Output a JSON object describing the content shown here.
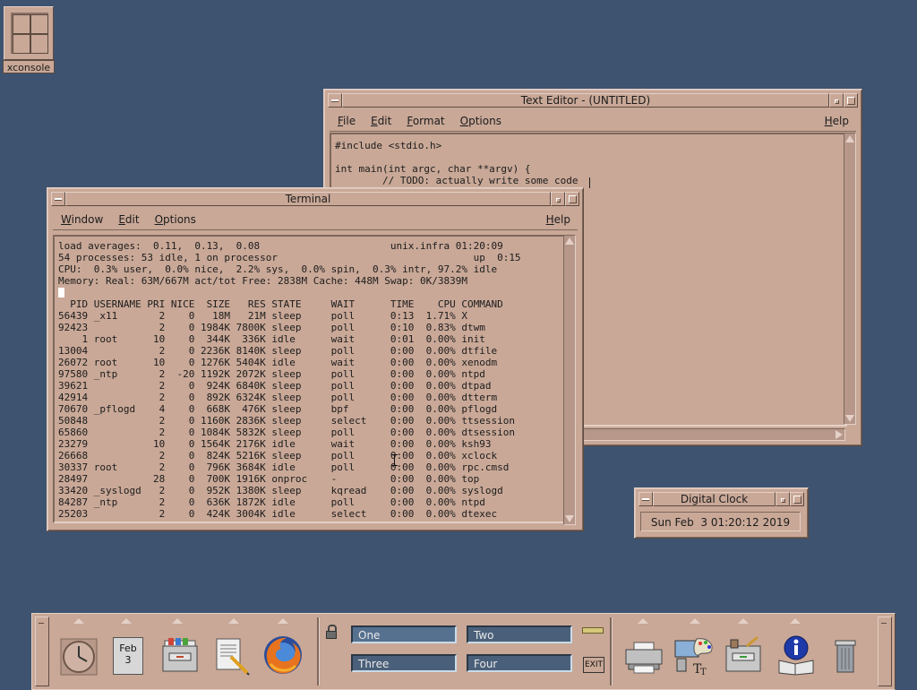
{
  "desktop": {
    "xconsole_label": "xconsole"
  },
  "text_editor": {
    "title": "Text Editor - (UNTITLED)",
    "menu": [
      "File",
      "Edit",
      "Format",
      "Options"
    ],
    "help": "Help",
    "content": "#include <stdio.h>\n\nint main(int argc, char **argv) {\n        // TODO: actually write some code"
  },
  "terminal": {
    "title": "Terminal",
    "menu": [
      "Window",
      "Edit",
      "Options"
    ],
    "help": "Help",
    "header_lines": [
      "load averages:  0.11,  0.13,  0.08                      unix.infra 01:20:09",
      "54 processes: 53 idle, 1 on processor                                 up  0:15",
      "CPU:  0.3% user,  0.0% nice,  2.2% sys,  0.0% spin,  0.3% intr, 97.2% idle",
      "Memory: Real: 63M/667M act/tot Free: 2838M Cache: 448M Swap: 0K/3839M"
    ],
    "columns_line": "  PID USERNAME PRI NICE  SIZE   RES STATE     WAIT      TIME    CPU COMMAND",
    "process_lines": [
      "56439 _x11       2    0   18M   21M sleep     poll      0:13  1.71% X",
      "92423            2    0 1984K 7800K sleep     poll      0:10  0.83% dtwm",
      "    1 root      10    0  344K  336K idle      wait      0:01  0.00% init",
      "13004            2    0 2236K 8140K sleep     poll      0:00  0.00% dtfile",
      "26072 root      10    0 1276K 5404K idle      wait      0:00  0.00% xenodm",
      "97580 _ntp       2  -20 1192K 2072K sleep     poll      0:00  0.00% ntpd",
      "39621            2    0  924K 6840K sleep     poll      0:00  0.00% dtpad",
      "42914            2    0  892K 6324K sleep     poll      0:00  0.00% dtterm",
      "70670 _pflogd    4    0  668K  476K sleep     bpf       0:00  0.00% pflogd",
      "50848            2    0 1160K 2836K sleep     select    0:00  0.00% ttsession",
      "65860            2    0 1084K 5832K sleep     poll      0:00  0.00% dtsession",
      "23279           10    0 1564K 2176K idle      wait      0:00  0.00% ksh93",
      "26668            2    0  824K 5216K sleep     poll      0:00  0.00% xclock",
      "30337 root       2    0  796K 3684K idle      poll      0:00  0.00% rpc.cmsd",
      "28497           28    0  700K 1916K onproc    -         0:00  0.00% top",
      "33420 _syslogd   2    0  952K 1380K sleep     kqread    0:00  0.00% syslogd",
      "84287 _ntp       2    0  636K 1872K idle      poll      0:00  0.00% ntpd",
      "25203            2    0  424K 3004K idle      select    0:00  0.00% dtexec"
    ]
  },
  "digital_clock": {
    "title": "Digital Clock",
    "text": "Sun Feb  3 01:20:12 2019"
  },
  "front_panel": {
    "calendar_month": "Feb",
    "calendar_day": "3",
    "workspaces": [
      "One",
      "Two",
      "Three",
      "Four"
    ],
    "exit_label": "EXIT"
  },
  "colors": {
    "desktop": "#3e5370",
    "window_face": "#c9a897",
    "workspace_button": "#4a607a"
  }
}
